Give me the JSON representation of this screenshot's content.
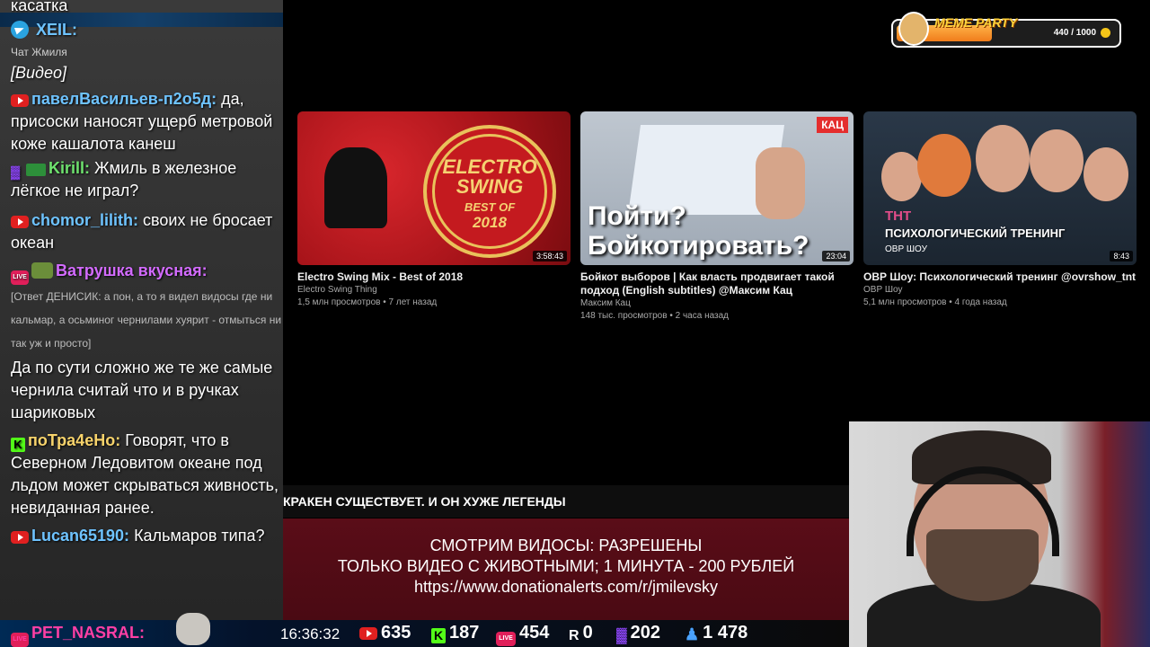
{
  "chat": {
    "messages": [
      {
        "type": "plain",
        "text": "касатка"
      },
      {
        "type": "msg",
        "platform": "telegram",
        "nick": "XEIL:",
        "nick_color": "#6ec3ff",
        "text": ""
      },
      {
        "type": "small",
        "text": "Чат Жмиля"
      },
      {
        "type": "italic",
        "text": "[Видео]"
      },
      {
        "type": "msg",
        "platform": "youtube",
        "nick": "павелВасильев-п2о5д:",
        "nick_color": "#6ec3ff",
        "text": " да, присоски наносят ущерб метровой коже кашалота канеш"
      },
      {
        "type": "msg",
        "platform": "twitch",
        "nick": "Kirill:",
        "nick_color": "#6ee26e",
        "text": " Жмиль в железное лёгкое не играл?"
      },
      {
        "type": "msg",
        "platform": "youtube",
        "nick": "chomor_lilith:",
        "nick_color": "#6ec3ff",
        "text": " своих не бросает океан"
      },
      {
        "type": "msg",
        "platform": "vk-live",
        "nick": "Ватрушка вкусная:",
        "nick_color": "#d36bff",
        "text": ""
      },
      {
        "type": "reply",
        "text": "[Ответ ДЕНИСИК: а пон, а то я видел видосы где ни кальмар, а осьминог чернилами хуярит - отмыться ни так уж и просто]"
      },
      {
        "type": "plain",
        "text": "Да по сути сложно же те же самые чернила считай что и в ручках шариковых"
      },
      {
        "type": "msg",
        "platform": "kick",
        "nick": "поТра4еНо:",
        "nick_color": "#f7d36b",
        "text": " Говорят, что в Северном Ледовитом океане под льдом может скрываться живность, невиданная ранее."
      },
      {
        "type": "msg",
        "platform": "youtube",
        "nick": "Lucan65190:",
        "nick_color": "#6ec3ff",
        "text": " Кальмаров типа?"
      }
    ]
  },
  "meme_party": {
    "title": "MEME PARTY",
    "count": "440 / 1000",
    "progress": 0.44
  },
  "videos": [
    {
      "title": "Electro Swing Mix - Best of 2018",
      "channel": "Electro Swing Thing",
      "meta": "1,5 млн просмотров • 7 лет назад",
      "duration": "3:58:43",
      "seal_line1": "ELECTRO",
      "seal_line2": "SWING",
      "seal_line3": "BEST OF",
      "seal_line4": "2018"
    },
    {
      "title": "Бойкот выборов | Как власть продвигает такой подход (English subtitles) @Максим Кац",
      "channel": "Максим Кац",
      "meta": "148 тыс. просмотров • 2 часа назад",
      "duration": "23:04",
      "thumb_text": "Пойти? Бойкотировать?",
      "badge": "КАЦ"
    },
    {
      "title": "ОВР Шоу: Психологический тренинг @ovrshow_tnt",
      "channel": "ОВР Шоу",
      "meta": "5,1 млн просмотров • 4 года назад",
      "duration": "8:43",
      "thumb_logo": "ТНТ",
      "thumb_text": "ПСИХОЛОГИЧЕСКИЙ ТРЕНИНГ",
      "thumb_sub": "ОВР ШОУ"
    }
  ],
  "headline": "КРАКЕН СУЩЕСТВУЕТ. И ОН ХУЖЕ ЛЕГЕНДЫ",
  "banner": {
    "line1": "СМОТРИМ ВИДОСЫ: РАЗРЕШЕНЫ",
    "line2": "ТОЛЬКО ВИДЕО С ЖИВОТНЫМИ; 1 МИНУТА - 200 РУБЛЕЙ",
    "line3": "https://www.donationalerts.com/r/jmilevsky"
  },
  "statbar": {
    "last_nick": "PET_NASRAL:",
    "time": "16:36:32",
    "youtube": "635",
    "kick": "187",
    "vk": "454",
    "rutube": "0",
    "twitch": "202",
    "total": "1 478"
  },
  "icons": {
    "youtube": "youtube-icon",
    "telegram": "telegram-icon",
    "twitch": "twitch-icon",
    "kick": "kick-icon",
    "vk_live": "vk-live-icon",
    "rutube": "rutube-icon",
    "viewers": "person-icon",
    "coin": "coin-icon"
  },
  "colors": {
    "accent_red": "#e02020",
    "kick_green": "#53fc18",
    "twitch_purple": "#9147ff",
    "banner_bg": "#5a0d18"
  }
}
